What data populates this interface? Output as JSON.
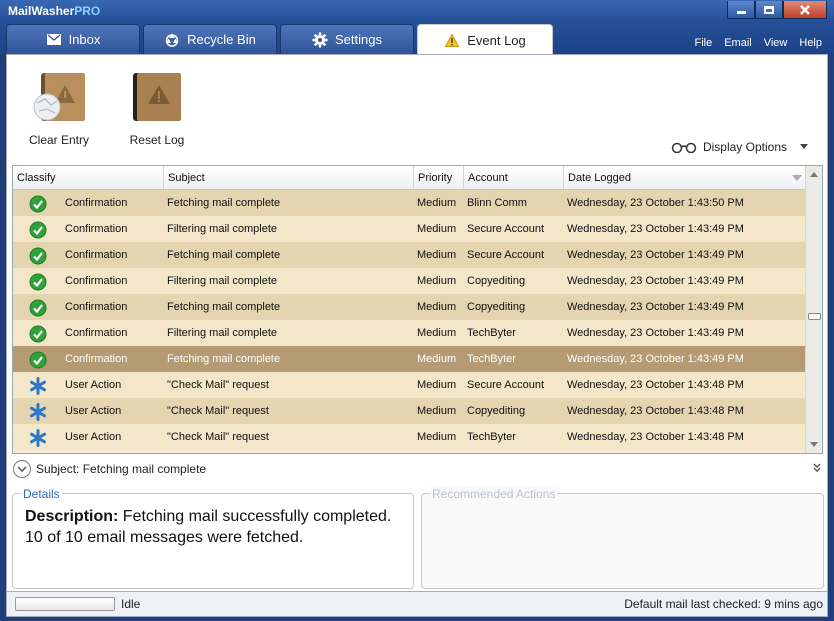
{
  "app": {
    "title_main": "MailWasher",
    "title_pro": "PRO",
    "window_buttons": [
      "minimize",
      "maximize",
      "close"
    ]
  },
  "tabs": [
    {
      "label": "Inbox",
      "icon": "envelope-icon",
      "active": false
    },
    {
      "label": "Recycle Bin",
      "icon": "recycle-icon",
      "active": false
    },
    {
      "label": "Settings",
      "icon": "gear-icon",
      "active": false
    },
    {
      "label": "Event Log",
      "icon": "warning-icon",
      "active": true
    }
  ],
  "menu": [
    "File",
    "Email",
    "View",
    "Help"
  ],
  "toolbar": {
    "clear_entry": "Clear Entry",
    "reset_log": "Reset Log",
    "display_options": "Display Options"
  },
  "grid": {
    "columns": [
      "Classify",
      "Subject",
      "Priority",
      "Account",
      "Date Logged"
    ],
    "sorted_column": "Date Logged",
    "rows": [
      {
        "icon": "check-icon",
        "classify": "Confirmation",
        "subject": "Fetching mail complete",
        "priority": "Medium",
        "account": "Blinn Comm",
        "date": "Wednesday, 23 October 1:43:50 PM"
      },
      {
        "icon": "check-icon",
        "classify": "Confirmation",
        "subject": "Filtering mail complete",
        "priority": "Medium",
        "account": "Secure Account",
        "date": "Wednesday, 23 October 1:43:49 PM"
      },
      {
        "icon": "check-icon",
        "classify": "Confirmation",
        "subject": "Fetching mail complete",
        "priority": "Medium",
        "account": "Secure Account",
        "date": "Wednesday, 23 October 1:43:49 PM"
      },
      {
        "icon": "check-icon",
        "classify": "Confirmation",
        "subject": "Filtering mail complete",
        "priority": "Medium",
        "account": "Copyediting",
        "date": "Wednesday, 23 October 1:43:49 PM"
      },
      {
        "icon": "check-icon",
        "classify": "Confirmation",
        "subject": "Fetching mail complete",
        "priority": "Medium",
        "account": "Copyediting",
        "date": "Wednesday, 23 October 1:43:49 PM"
      },
      {
        "icon": "check-icon",
        "classify": "Confirmation",
        "subject": "Filtering mail complete",
        "priority": "Medium",
        "account": "TechByter",
        "date": "Wednesday, 23 October 1:43:49 PM"
      },
      {
        "icon": "check-icon",
        "classify": "Confirmation",
        "subject": "Fetching mail complete",
        "priority": "Medium",
        "account": "TechByter",
        "date": "Wednesday, 23 October 1:43:49 PM",
        "selected": true
      },
      {
        "icon": "asterisk-icon",
        "classify": "User Action",
        "subject": "\"Check Mail\" request",
        "priority": "Medium",
        "account": "Secure Account",
        "date": "Wednesday, 23 October 1:43:48 PM"
      },
      {
        "icon": "asterisk-icon",
        "classify": "User Action",
        "subject": "\"Check Mail\" request",
        "priority": "Medium",
        "account": "Copyediting",
        "date": "Wednesday, 23 October 1:43:48 PM"
      },
      {
        "icon": "asterisk-icon",
        "classify": "User Action",
        "subject": "\"Check Mail\" request",
        "priority": "Medium",
        "account": "TechByter",
        "date": "Wednesday, 23 October 1:43:48 PM"
      }
    ]
  },
  "subject_line": "Subject: Fetching mail complete",
  "details": {
    "title": "Details",
    "label": "Description:",
    "text": " Fetching mail successfully completed. 10 of 10 email messages were fetched."
  },
  "recommended": {
    "title": "Recommended Actions"
  },
  "status": {
    "state": "Idle",
    "last_checked": "Default mail last checked: 9 mins ago"
  },
  "colors": {
    "title_bar": "#254f97",
    "row_odd": "#e4d4b0",
    "row_even": "#f3e6c9",
    "row_selected": "#b59b74",
    "check_green": "#2fa33a",
    "asterisk_blue": "#2d78c8"
  }
}
